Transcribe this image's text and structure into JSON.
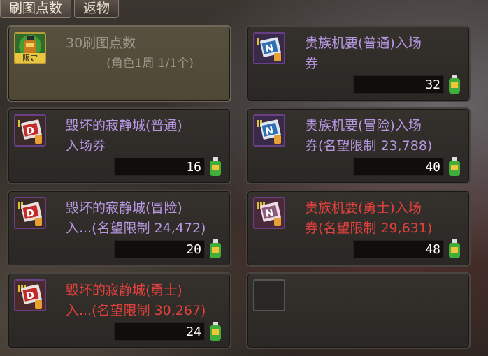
{
  "tabs": [
    {
      "label": "刷图点数"
    },
    {
      "label": "返物"
    }
  ],
  "items": [
    {
      "name": "30刷图点数",
      "note": "(角色1周 1/1个)",
      "badge": "限定",
      "price": ""
    },
    {
      "name": "贵族机要(普通)入场\n券",
      "price": "32",
      "icon_letter": "N"
    },
    {
      "name": "毁坏的寂静城(普通)\n入场券",
      "price": "16",
      "icon_letter": "D"
    },
    {
      "name": "贵族机要(冒险)入场\n券(名望限制 23,788)",
      "price": "40",
      "icon_letter": "N"
    },
    {
      "name": "毁坏的寂静城(冒险)\n入...(名望限制 24,472)",
      "price": "20",
      "icon_letter": "D"
    },
    {
      "name": "贵族机要(勇士)入场\n券(名望限制 29,631)",
      "price": "48",
      "icon_letter": "N"
    },
    {
      "name": "毁坏的寂静城(勇士)\n入...(名望限制 30,267)",
      "price": "24",
      "icon_letter": "D"
    }
  ],
  "colors": {
    "rare_purple": "#b697e0",
    "epic_red": "#e2413d",
    "muted": "#9a9488"
  }
}
